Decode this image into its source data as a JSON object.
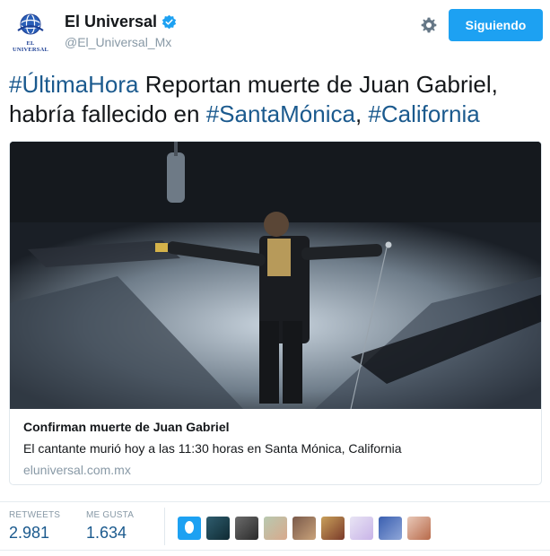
{
  "header": {
    "avatar_wordmark": "EL UNIVERSAL",
    "display_name": "El Universal",
    "handle": "@El_Universal_Mx",
    "follow_label": "Siguiendo"
  },
  "tweet": {
    "hashtag1": "#ÚltimaHora",
    "text1": " Reportan muerte de Juan Gabriel,",
    "text2": "habría fallecido en ",
    "hashtag2": "#SantaMónica",
    "comma": ", ",
    "hashtag3": "#California"
  },
  "card": {
    "title": "Confirman muerte de Juan Gabriel",
    "description": "El cantante murió hoy a las 11:30 horas en Santa Mónica, California",
    "domain": "eluniversal.com.mx"
  },
  "stats": {
    "retweets_label": "RETWEETS",
    "retweets_value": "2.981",
    "likes_label": "ME GUSTA",
    "likes_value": "1.634"
  },
  "colors": {
    "accent": "#1da1f2",
    "hashtag": "#1b5a8e",
    "muted": "#8899a6"
  },
  "icons": [
    "verified-badge-icon",
    "gear-icon"
  ]
}
